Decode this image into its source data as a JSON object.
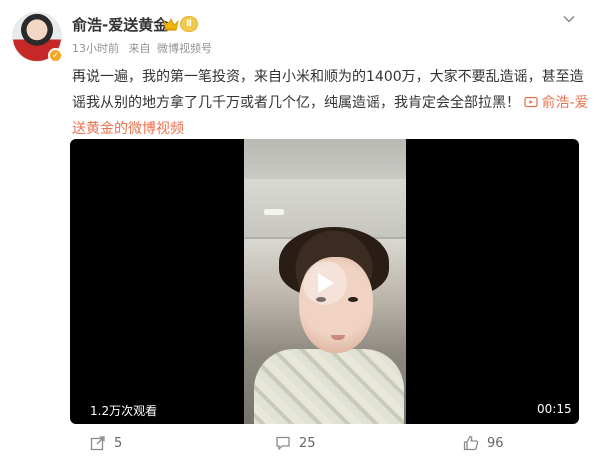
{
  "post": {
    "author_name": "俞浩-爱送黄金",
    "level_badge": "Ⅱ",
    "time": "13小时前",
    "source_prefix": "来自",
    "source": "微博视频号",
    "text": "再说一遍，我的第一笔投资，来自小米和顺为的1400万，大家不要乱造谣，甚至造谣我从别的地方拿了几千万或者几个亿，纯属造谣，我肯定会全部拉黑！",
    "video_link": "俞浩-爱送黄金的微博视频"
  },
  "video": {
    "views": "1.2万次观看",
    "duration": "00:15"
  },
  "actions": {
    "share_count": "5",
    "comment_count": "25",
    "like_count": "96"
  },
  "colors": {
    "link": "#eb7350",
    "meta": "#939393",
    "badge": "#f2c94c"
  }
}
